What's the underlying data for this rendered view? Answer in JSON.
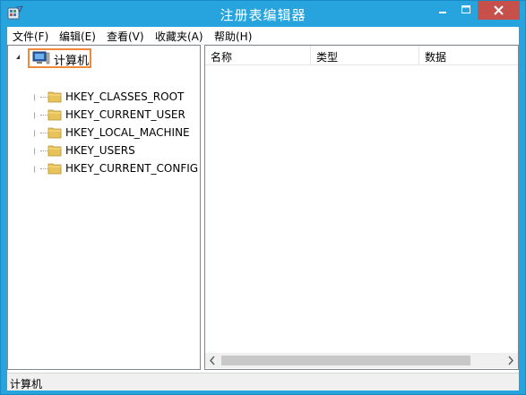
{
  "window": {
    "title": "注册表编辑器"
  },
  "menu": [
    {
      "label": "文件(F)"
    },
    {
      "label": "编辑(E)"
    },
    {
      "label": "查看(V)"
    },
    {
      "label": "收藏夹(A)"
    },
    {
      "label": "帮助(H)"
    }
  ],
  "tree": {
    "root_label": "计算机",
    "items": [
      {
        "label": "HKEY_CLASSES_ROOT"
      },
      {
        "label": "HKEY_CURRENT_USER"
      },
      {
        "label": "HKEY_LOCAL_MACHINE"
      },
      {
        "label": "HKEY_USERS"
      },
      {
        "label": "HKEY_CURRENT_CONFIG"
      }
    ]
  },
  "list": {
    "columns": [
      {
        "label": "名称"
      },
      {
        "label": "类型"
      },
      {
        "label": "数据"
      }
    ]
  },
  "status": {
    "text": "计算机"
  },
  "colors": {
    "title_bar": "#27a3de",
    "close_button": "#c7504a",
    "selection_highlight": "#f08a3a",
    "folder": "#e8c35a"
  },
  "icons": {
    "app": "regedit-icon",
    "root": "computer-icon",
    "keys": "folder-icon"
  }
}
